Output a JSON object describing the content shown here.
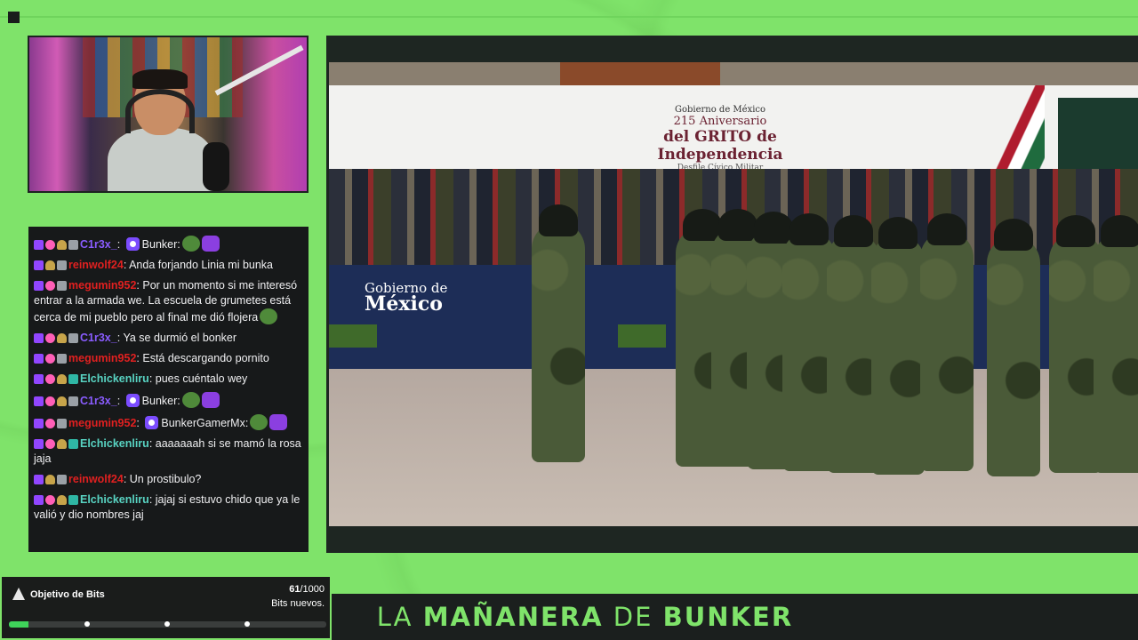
{
  "chat": {
    "messages": [
      {
        "user": "C1r3x_",
        "user_color": "#8a5cff",
        "text": "Bunker:",
        "emotes": [
          "pepe-emote",
          "chat-emote"
        ]
      },
      {
        "user": "reinwolf24",
        "user_color": "#e02020",
        "text": "Anda forjando Linia mi bunka"
      },
      {
        "user": "megumin952",
        "user_color": "#e02020",
        "text": "Por un momento si me interesó entrar a la armada we. La escuela de grumetes está cerca de mi pueblo pero al final me dió flojera"
      },
      {
        "user": "C1r3x_",
        "user_color": "#8a5cff",
        "text": "Ya se durmió el bonker"
      },
      {
        "user": "megumin952",
        "user_color": "#e02020",
        "text": "Está descargando pornito"
      },
      {
        "user": "Elchickenliru",
        "user_color": "#58d3c2",
        "text": "pues cuéntalo wey"
      },
      {
        "user": "C1r3x_",
        "user_color": "#8a5cff",
        "text": "Bunker:",
        "emotes": [
          "pepe-emote",
          "chat-emote"
        ]
      },
      {
        "user": "megumin952",
        "user_color": "#e02020",
        "text": "BunkerGamerMx:",
        "emotes": [
          "pepe-emote",
          "chat-emote"
        ]
      },
      {
        "user": "Elchickenliru",
        "user_color": "#58d3c2",
        "text": "aaaaaaah si se mamó la rosa jaja"
      },
      {
        "user": "reinwolf24",
        "user_color": "#e02020",
        "text": "Un prostibulo?"
      },
      {
        "user": "Elchickenliru",
        "user_color": "#58d3c2",
        "text": "jajaj si estuvo chido que ya le valió y dio nombres jaj"
      }
    ]
  },
  "video": {
    "banner_gov": "Gobierno de México",
    "banner_line1": "215 Aniversario",
    "banner_line2": "del GRITO de",
    "banner_line3": "Independencia",
    "banner_line4": "Desfile Cívico Militar",
    "stage_line1": "Gobierno de",
    "stage_line2": "México"
  },
  "bits_goal": {
    "label": "Objetivo de Bits",
    "current": "61",
    "total": "/1000",
    "subtitle": "Bits nuevos.",
    "progress": 0.061
  },
  "footer": {
    "word1": "LA",
    "word2": "MAÑANERA",
    "word3": "DE",
    "word4": "BUNKER"
  },
  "colors": {
    "accent": "#7fe36a",
    "panel": "#1b1f1e",
    "chat_bg": "#17191a"
  }
}
